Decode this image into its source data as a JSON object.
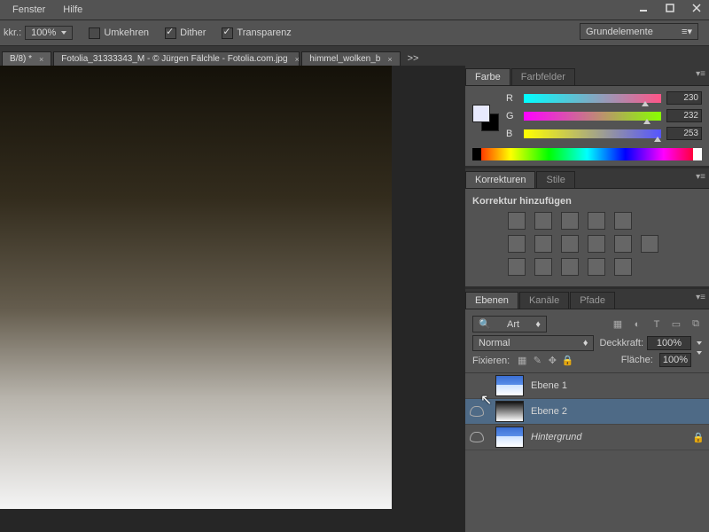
{
  "menu": {
    "window": "Fenster",
    "help": "Hilfe"
  },
  "optbar": {
    "opacity_label": "kkr.:",
    "opacity_val": "100%",
    "reverse": "Umkehren",
    "dither": "Dither",
    "transparency": "Transparenz",
    "workspace": "Grundelemente"
  },
  "tabs": {
    "t1": "B/8) *",
    "t2": "Fotolia_31333343_M - © Jürgen Fälchle - Fotolia.com.jpg",
    "t3": "himmel_wolken_b",
    "overflow": ">>"
  },
  "color_panel": {
    "tab_color": "Farbe",
    "tab_swatches": "Farbfelder",
    "r_label": "R",
    "g_label": "G",
    "b_label": "B",
    "r": "230",
    "g": "232",
    "b": "253"
  },
  "adjust_panel": {
    "tab_adjust": "Korrekturen",
    "tab_styles": "Stile",
    "add_adjust": "Korrektur hinzufügen"
  },
  "layers_panel": {
    "tab_layers": "Ebenen",
    "tab_channels": "Kanäle",
    "tab_paths": "Pfade",
    "search_placeholder": "Art",
    "blend_mode": "Normal",
    "opacity_label": "Deckkraft:",
    "opacity_val": "100%",
    "lock_label": "Fixieren:",
    "fill_label": "Fläche:",
    "fill_val": "100%",
    "layers": {
      "l1": "Ebene 1",
      "l2": "Ebene 2",
      "bg": "Hintergrund"
    }
  }
}
